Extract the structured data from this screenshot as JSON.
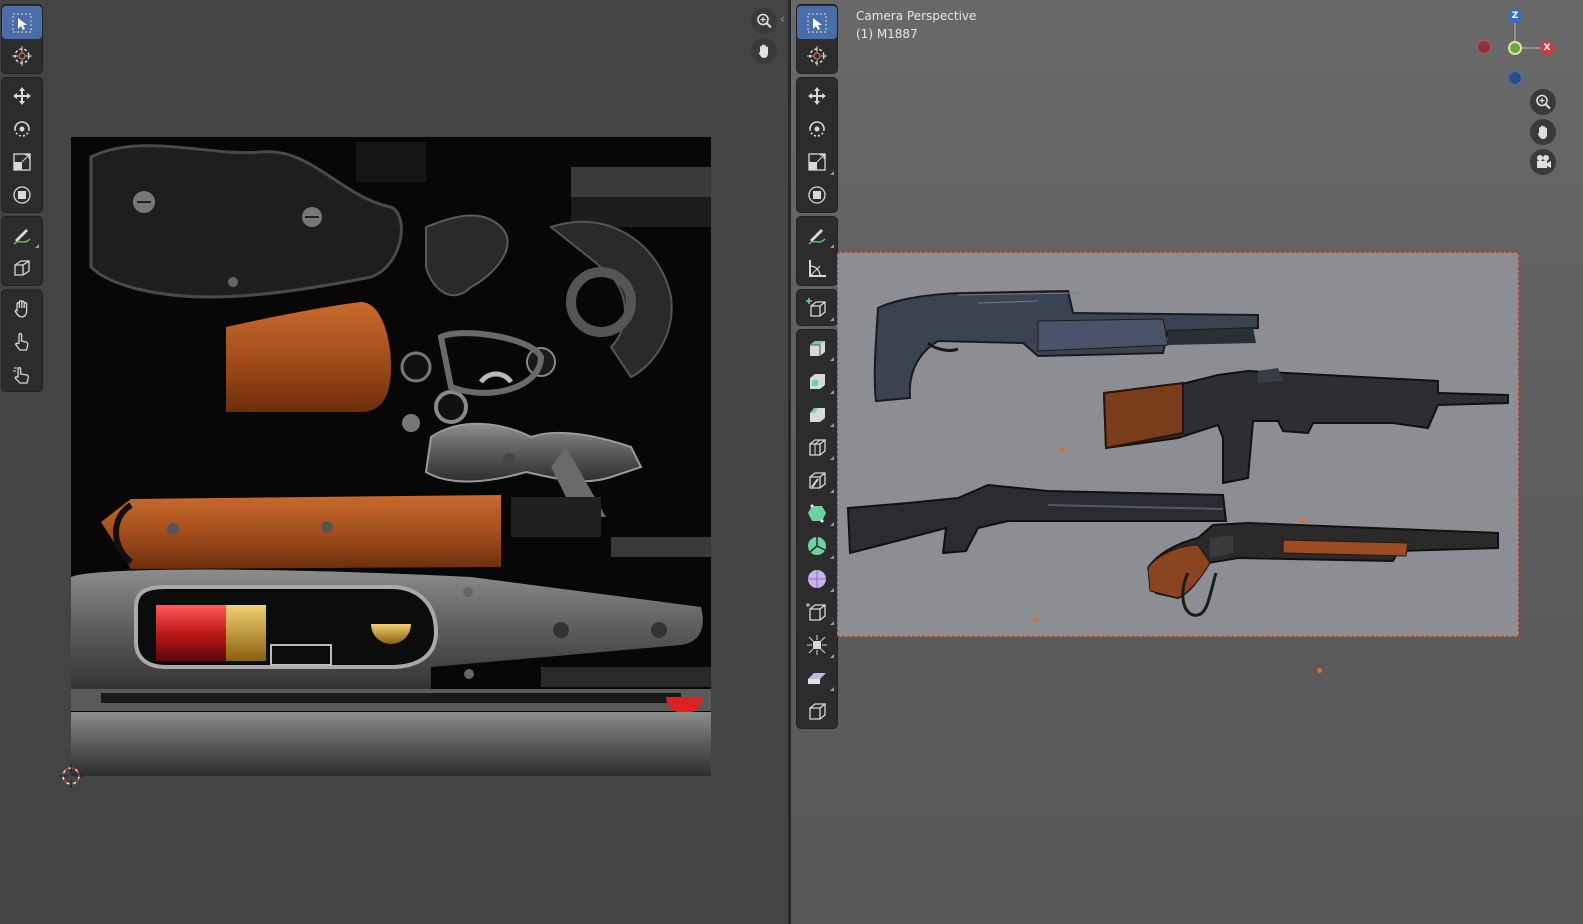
{
  "viewport": {
    "mode": "Camera Perspective",
    "object": "(1) M1887"
  },
  "gizmo": {
    "x_label": "X",
    "y_label": "",
    "z_label": "Z",
    "colors": {
      "x": "#d03c44",
      "y": "#6aa63c",
      "z": "#3c6cc0"
    }
  },
  "icons": {
    "uv_tools": [
      "select-box-icon",
      "cursor-icon",
      "move-icon",
      "rotate-icon",
      "scale-icon",
      "transform-icon",
      "annotate-icon",
      "cube-project-icon",
      "grab-icon",
      "pinch-icon",
      "relax-icon"
    ],
    "viewport_tools": [
      "select-box-icon",
      "cursor-icon",
      "move-icon",
      "rotate-icon",
      "scale-icon",
      "transform-icon",
      "annotate-icon",
      "measure-icon",
      "add-cube-icon",
      "extrude-icon",
      "inset-icon",
      "bevel-icon",
      "loop-cut-icon",
      "knife-icon",
      "poly-build-icon",
      "spin-icon",
      "smooth-icon",
      "edge-slide-icon",
      "shrink-fatten-icon",
      "shear-icon",
      "rip-icon"
    ]
  },
  "colors": {
    "active_tool": "#4a6fa8",
    "origin_dot": "#d7702a",
    "camera_border": "#b04020"
  }
}
